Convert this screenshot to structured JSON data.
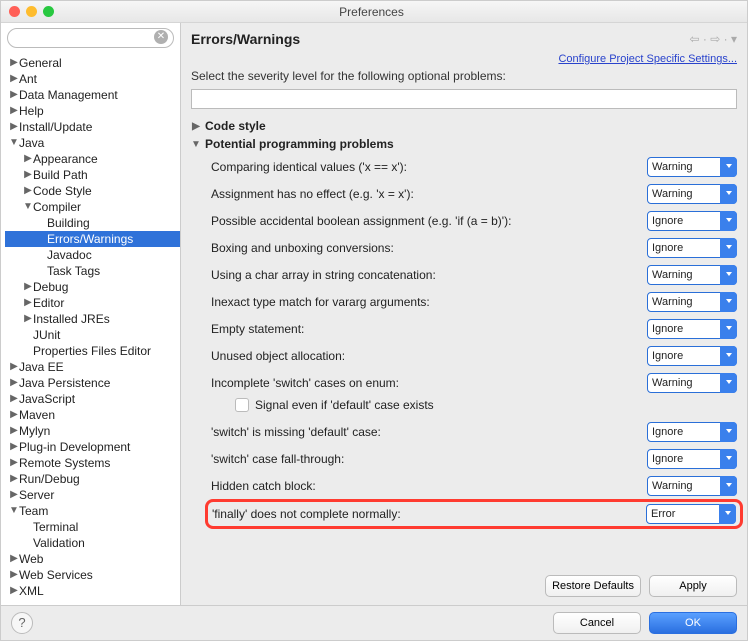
{
  "window": {
    "title": "Preferences"
  },
  "sidebar": {
    "search_placeholder": "",
    "tree": [
      {
        "label": "General",
        "depth": 0,
        "arrow": "▶"
      },
      {
        "label": "Ant",
        "depth": 0,
        "arrow": "▶"
      },
      {
        "label": "Data Management",
        "depth": 0,
        "arrow": "▶"
      },
      {
        "label": "Help",
        "depth": 0,
        "arrow": "▶"
      },
      {
        "label": "Install/Update",
        "depth": 0,
        "arrow": "▶"
      },
      {
        "label": "Java",
        "depth": 0,
        "arrow": "▼"
      },
      {
        "label": "Appearance",
        "depth": 1,
        "arrow": "▶"
      },
      {
        "label": "Build Path",
        "depth": 1,
        "arrow": "▶"
      },
      {
        "label": "Code Style",
        "depth": 1,
        "arrow": "▶"
      },
      {
        "label": "Compiler",
        "depth": 1,
        "arrow": "▼"
      },
      {
        "label": "Building",
        "depth": 2,
        "arrow": ""
      },
      {
        "label": "Errors/Warnings",
        "depth": 2,
        "arrow": "",
        "selected": true
      },
      {
        "label": "Javadoc",
        "depth": 2,
        "arrow": ""
      },
      {
        "label": "Task Tags",
        "depth": 2,
        "arrow": ""
      },
      {
        "label": "Debug",
        "depth": 1,
        "arrow": "▶"
      },
      {
        "label": "Editor",
        "depth": 1,
        "arrow": "▶"
      },
      {
        "label": "Installed JREs",
        "depth": 1,
        "arrow": "▶"
      },
      {
        "label": "JUnit",
        "depth": 1,
        "arrow": ""
      },
      {
        "label": "Properties Files Editor",
        "depth": 1,
        "arrow": ""
      },
      {
        "label": "Java EE",
        "depth": 0,
        "arrow": "▶"
      },
      {
        "label": "Java Persistence",
        "depth": 0,
        "arrow": "▶"
      },
      {
        "label": "JavaScript",
        "depth": 0,
        "arrow": "▶"
      },
      {
        "label": "Maven",
        "depth": 0,
        "arrow": "▶"
      },
      {
        "label": "Mylyn",
        "depth": 0,
        "arrow": "▶"
      },
      {
        "label": "Plug-in Development",
        "depth": 0,
        "arrow": "▶"
      },
      {
        "label": "Remote Systems",
        "depth": 0,
        "arrow": "▶"
      },
      {
        "label": "Run/Debug",
        "depth": 0,
        "arrow": "▶"
      },
      {
        "label": "Server",
        "depth": 0,
        "arrow": "▶"
      },
      {
        "label": "Team",
        "depth": 0,
        "arrow": "▼"
      },
      {
        "label": "Terminal",
        "depth": 1,
        "arrow": ""
      },
      {
        "label": "Validation",
        "depth": 1,
        "arrow": ""
      },
      {
        "label": "Web",
        "depth": 0,
        "arrow": "▶"
      },
      {
        "label": "Web Services",
        "depth": 0,
        "arrow": "▶"
      },
      {
        "label": "XML",
        "depth": 0,
        "arrow": "▶"
      }
    ]
  },
  "page": {
    "heading": "Errors/Warnings",
    "configure_link": "Configure Project Specific Settings...",
    "description": "Select the severity level for the following optional problems:",
    "group_code_style": "Code style",
    "group_potential": "Potential programming problems",
    "options": [
      "Error",
      "Warning",
      "Ignore"
    ],
    "rows": [
      {
        "label": "Comparing identical values ('x == x'):",
        "value": "Warning"
      },
      {
        "label": "Assignment has no effect (e.g. 'x = x'):",
        "value": "Warning"
      },
      {
        "label": "Possible accidental boolean assignment (e.g. 'if (a = b)'):",
        "value": "Ignore"
      },
      {
        "label": "Boxing and unboxing conversions:",
        "value": "Ignore"
      },
      {
        "label": "Using a char array in string concatenation:",
        "value": "Warning"
      },
      {
        "label": "Inexact type match for vararg arguments:",
        "value": "Warning"
      },
      {
        "label": "Empty statement:",
        "value": "Ignore"
      },
      {
        "label": "Unused object allocation:",
        "value": "Ignore"
      },
      {
        "label": "Incomplete 'switch' cases on enum:",
        "value": "Warning"
      },
      {
        "checkbox": true,
        "label": "Signal even if 'default' case exists"
      },
      {
        "label": "'switch' is missing 'default' case:",
        "value": "Ignore"
      },
      {
        "label": "'switch' case fall-through:",
        "value": "Ignore"
      },
      {
        "label": "Hidden catch block:",
        "value": "Warning"
      },
      {
        "label": "'finally' does not complete normally:",
        "value": "Error",
        "highlight": true
      }
    ],
    "restore": "Restore Defaults",
    "apply": "Apply"
  },
  "footer": {
    "cancel": "Cancel",
    "ok": "OK"
  }
}
